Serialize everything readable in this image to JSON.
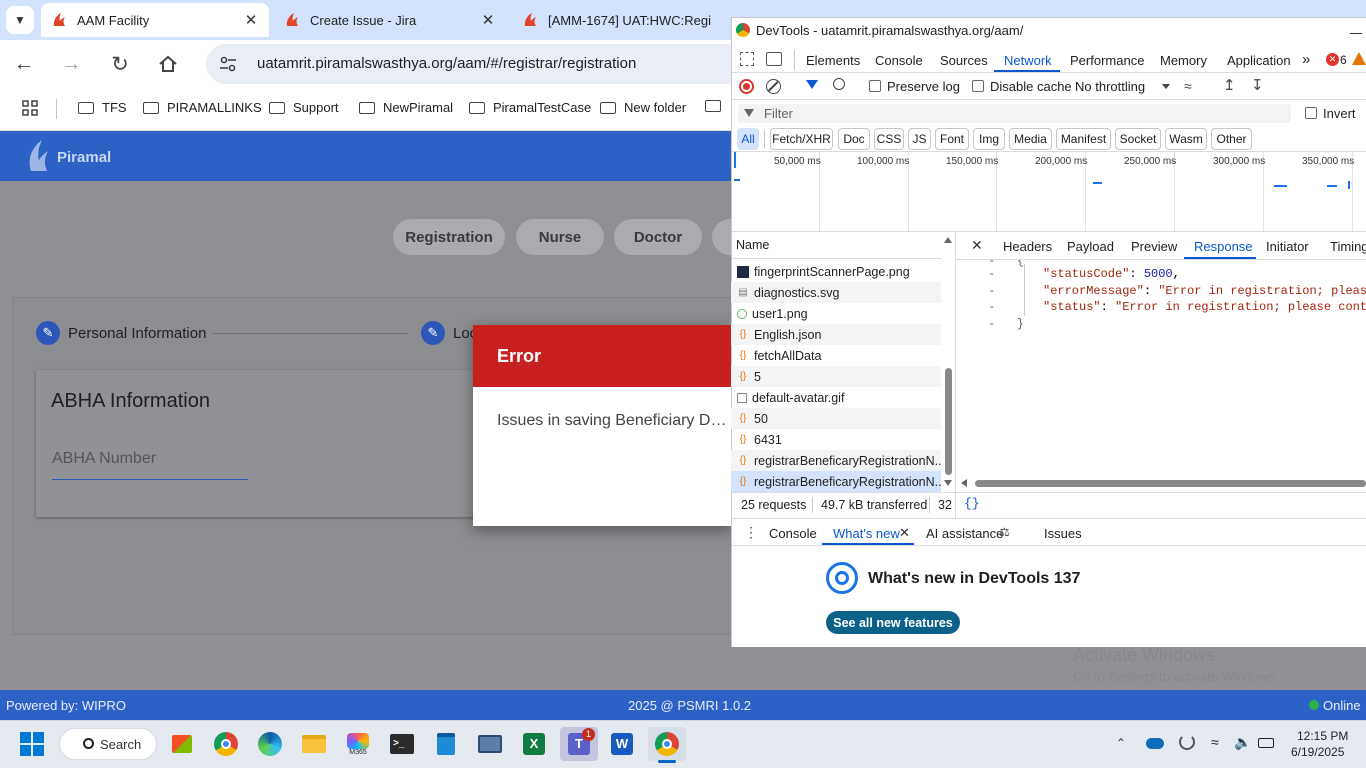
{
  "browser": {
    "tabs": [
      {
        "title": "AAM Facility",
        "active": true
      },
      {
        "title": "Create Issue - Jira",
        "active": false
      },
      {
        "title": "[AMM-1674] UAT:HWC:Regi",
        "active": false
      }
    ],
    "url": "uatamrit.piramalswasthya.org/aam/#/registrar/registration",
    "bookmarks": [
      "TFS",
      "PIRAMALLINKS",
      "Support",
      "NewPiramal",
      "PiramalTestCase",
      "New folder"
    ]
  },
  "app": {
    "brand": "Piramal",
    "nav_pills": [
      "Registration",
      "Nurse",
      "Doctor"
    ],
    "steps": {
      "step1": "Personal Information",
      "step2_partial": "Loc"
    },
    "abha": {
      "title": "ABHA Information",
      "field_placeholder": "ABHA Number"
    },
    "dialog": {
      "title": "Error",
      "message": "Issues in saving Beneficiary Data"
    },
    "footer": {
      "left": "Powered by: WIPRO",
      "center": "2025 @ PSMRI 1.0.2",
      "right": "Online"
    }
  },
  "devtools": {
    "title": "DevTools - uatamrit.piramalswasthya.org/aam/",
    "panels": [
      "Elements",
      "Console",
      "Sources",
      "Network",
      "Performance",
      "Memory",
      "Application"
    ],
    "active_panel": "Network",
    "issue_count": "6",
    "preserve_log": "Preserve log",
    "disable_cache": "Disable cache",
    "throttling": "No throttling",
    "filter_placeholder": "Filter",
    "invert": "Invert",
    "type_filters": [
      "All",
      "Fetch/XHR",
      "Doc",
      "CSS",
      "JS",
      "Font",
      "Img",
      "Media",
      "Manifest",
      "Socket",
      "Wasm",
      "Other"
    ],
    "timeline_ticks": [
      "50,000 ms",
      "100,000 ms",
      "150,000 ms",
      "200,000 ms",
      "250,000 ms",
      "300,000 ms",
      "350,000 ms"
    ],
    "name_header": "Name",
    "requests": [
      {
        "name": "fingerprintScannerPage.png",
        "icon": "image-icon"
      },
      {
        "name": "diagnostics.svg",
        "icon": "svg-icon"
      },
      {
        "name": "user1.png",
        "icon": "image-icon"
      },
      {
        "name": "English.json",
        "icon": "json-icon"
      },
      {
        "name": "fetchAllData",
        "icon": "json-icon"
      },
      {
        "name": "5",
        "icon": "json-icon"
      },
      {
        "name": "default-avatar.gif",
        "icon": "image-icon"
      },
      {
        "name": "50",
        "icon": "json-icon"
      },
      {
        "name": "6431",
        "icon": "json-icon"
      },
      {
        "name": "registrarBeneficaryRegistrationN...",
        "icon": "json-icon"
      },
      {
        "name": "registrarBeneficaryRegistrationN...",
        "icon": "json-icon",
        "selected": true
      }
    ],
    "detail_tabs": [
      "Headers",
      "Payload",
      "Preview",
      "Response",
      "Initiator",
      "Timing"
    ],
    "active_detail_tab": "Response",
    "response_lines": [
      {
        "key": "\"statusCode\"",
        "value": "5000",
        "suffix": ","
      },
      {
        "key": "\"errorMessage\"",
        "value": "\"Error in registration; please co",
        "suffix": ""
      },
      {
        "key": "\"status\"",
        "value": "\"Error in registration; please contact",
        "suffix": ""
      }
    ],
    "status_bar": {
      "requests": "25 requests",
      "transferred": "49.7 kB transferred",
      "extra": "32"
    },
    "drawer_tabs": [
      "Console",
      "What's new",
      "AI assistance",
      "Issues"
    ],
    "active_drawer_tab": "What's new",
    "whats_new_title": "What's new in DevTools 137",
    "see_all_button": "See all new features"
  },
  "watermark": {
    "line1": "Activate Windows",
    "line2": "Go to Settings to activate Windows."
  },
  "taskbar": {
    "search_label": "Search",
    "time": "12:15 PM",
    "date": "6/19/2025",
    "teams_badge": "1",
    "m365_label": "M365"
  }
}
